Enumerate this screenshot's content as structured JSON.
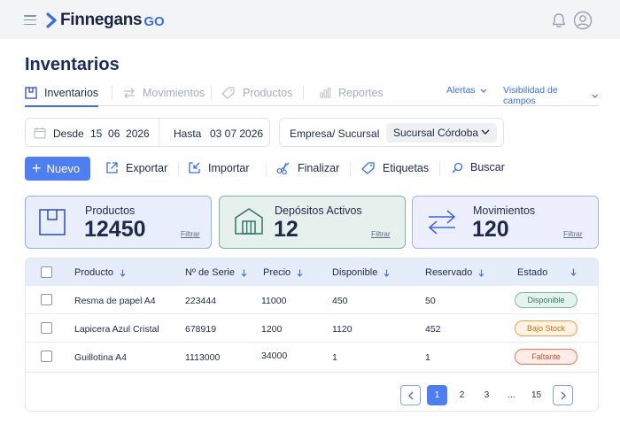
{
  "app": {
    "logo_text": "Finnegans",
    "logo_suffix": "GO"
  },
  "page": {
    "title": "Inventarios"
  },
  "tabs": [
    {
      "label": "Inventarios",
      "icon": "box-icon",
      "active": true
    },
    {
      "label": "Movimientos",
      "icon": "arrows-icon",
      "active": false
    },
    {
      "label": "Productos",
      "icon": "tag-icon",
      "active": false
    },
    {
      "label": "Reportes",
      "icon": "bar-chart-icon",
      "active": false
    }
  ],
  "tab_links": {
    "alerts": "Alertas",
    "visibility": "Visibilidad de campos"
  },
  "filters": {
    "from_label": "Desde",
    "from_value": "15  06  2026",
    "to_label": "Hasta",
    "to_value": "03 07 2026",
    "company_label": "Empresa/ Sucursal",
    "company_value": "Sucursal Córdoba"
  },
  "toolbar": {
    "new": "Nuevo",
    "export": "Exportar",
    "import": "Importar",
    "finalize": "Finalizar",
    "labels": "Etiquetas",
    "search": "Buscar"
  },
  "cards": [
    {
      "title": "Productos",
      "value": "12450",
      "link": "Filtrar"
    },
    {
      "title": "Depósitos Activos",
      "value": "12",
      "link": "Filtrar"
    },
    {
      "title": "Movimientos",
      "value": "120",
      "link": "Filtrar"
    }
  ],
  "table": {
    "headers": [
      "Producto",
      "Nº de Serie",
      "Precio",
      "Disponible",
      "Reservado",
      "Estado"
    ],
    "rows": [
      {
        "product": "Resma de papel A4",
        "serial": "223444",
        "price": "11000",
        "available": "450",
        "reserved": "50",
        "status": "Disponible"
      },
      {
        "product": "Lapicera Azul Cristal",
        "serial": "678919",
        "price": "1200",
        "available": "1120",
        "reserved": "452",
        "status": "Bajo Stock"
      },
      {
        "product": "Guillotina A4",
        "serial": "1113000",
        "price": "34000",
        "available": "1",
        "reserved": "1",
        "status": "Faltante"
      }
    ]
  },
  "pagination": {
    "pages": [
      "1",
      "2",
      "3",
      "...",
      "15"
    ],
    "current": "1"
  },
  "colors": {
    "accent": "#4e7ef0",
    "card_products_bg": "#e8eefb",
    "card_depots_bg": "#e6f0ec",
    "card_movements_bg": "#eeeffd",
    "status_available": "#2f7a65",
    "status_low": "#c77415",
    "status_missing": "#c4522f"
  }
}
